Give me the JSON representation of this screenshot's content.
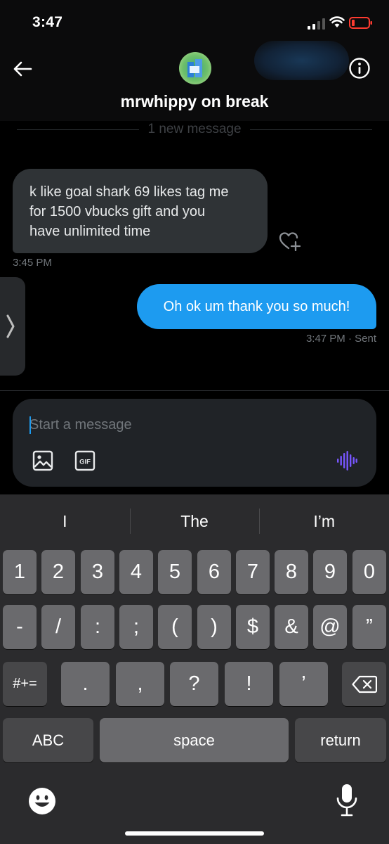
{
  "status_bar": {
    "time": "3:47"
  },
  "header": {
    "title": "mrwhippy on break"
  },
  "divider": {
    "text": "1 new message"
  },
  "messages": {
    "received": {
      "line1": "k like goal shark 69 likes tag me",
      "line2": "for 1500 vbucks gift and you",
      "line3": "have unlimited time",
      "timestamp": "3:45 PM"
    },
    "sent": {
      "text": "Oh ok um thank you so much!",
      "timestamp": "3:47 PM · Sent"
    }
  },
  "composer": {
    "placeholder": "Start a message"
  },
  "keyboard": {
    "suggestions": [
      "I",
      "The",
      "I’m"
    ],
    "row1": [
      "1",
      "2",
      "3",
      "4",
      "5",
      "6",
      "7",
      "8",
      "9",
      "0"
    ],
    "row2": [
      "-",
      "/",
      ":",
      ";",
      "(",
      ")",
      "$",
      "&",
      "@",
      "”"
    ],
    "row3": {
      "toggle": "#+=",
      "keys": [
        ".",
        ",",
        "?",
        "!",
        "’"
      ]
    },
    "row4": {
      "abc": "ABC",
      "space": "space",
      "return": "return"
    }
  },
  "colors": {
    "accent": "#1d9bf0",
    "bubble_in": "#2f3336",
    "voice": "#7856ff"
  }
}
